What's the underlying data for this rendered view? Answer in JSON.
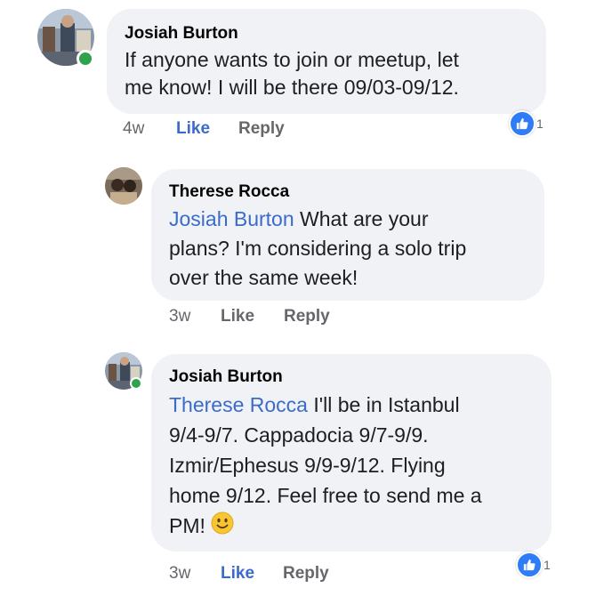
{
  "comments": [
    {
      "author": "Josiah Burton",
      "lines": [
        "If anyone wants to join or meetup, let",
        "me know! I will be there 09/03-09/12."
      ],
      "time": "4w",
      "like_label": "Like",
      "reply_label": "Reply",
      "liked": true,
      "online": true,
      "reaction_icon": "thumbs-up-icon",
      "reaction_count": "1"
    },
    {
      "author": "Therese Rocca",
      "mention": "Josiah Burton",
      "lines": [
        " What are your",
        "plans? I'm considering a solo trip",
        "over the same week!"
      ],
      "time": "3w",
      "like_label": "Like",
      "reply_label": "Reply",
      "liked": false,
      "online": false
    },
    {
      "author": "Josiah Burton",
      "mention": "Therese Rocca",
      "lines": [
        " I'll be in Istanbul",
        "9/4-9/7. Cappadocia 9/7-9/9.",
        "Izmir/Ephesus 9/9-9/12. Flying",
        "home 9/12. Feel free to send me a",
        "PM! "
      ],
      "emoji": "smiley-emoji",
      "time": "3w",
      "like_label": "Like",
      "reply_label": "Reply",
      "liked": true,
      "online": true,
      "reaction_icon": "thumbs-up-icon",
      "reaction_count": "1"
    }
  ],
  "colors": {
    "bubble": "#f0f2f5",
    "mention": "#3b6bc9",
    "like_active": "#3b6bc9",
    "meta": "#65676b",
    "online": "#31a24c",
    "reaction": "#2e7cf6"
  }
}
